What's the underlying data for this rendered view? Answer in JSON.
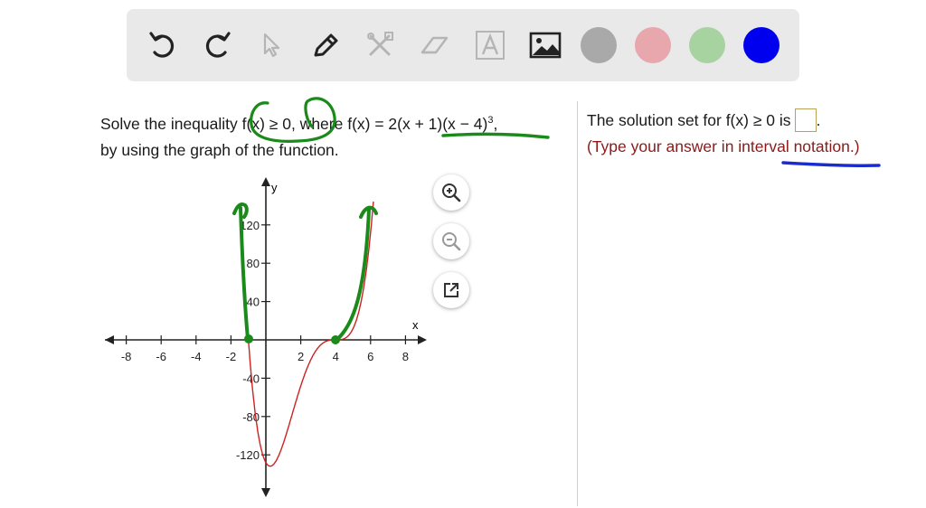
{
  "toolbar": {
    "tools": [
      "undo-icon",
      "redo-icon",
      "select-pointer-icon",
      "pen-icon",
      "tools-icon",
      "eraser-icon",
      "text-icon",
      "image-icon"
    ],
    "colors": [
      "#a9a9a9",
      "#e8a6ad",
      "#a7d3a1",
      "#0000ee"
    ]
  },
  "problem": {
    "part1": "Solve the inequality f(x) ≥ 0, where f(x) = 2(x + 1)(x − 4)",
    "exponent": "3",
    "part2": ",",
    "line2": "by using the graph of the function."
  },
  "answer": {
    "prompt": "The solution set for f(x) ≥ 0 is",
    "prompt_end": ".",
    "hint": "(Type your answer in interval notation.)",
    "value": ""
  },
  "graph": {
    "x_label": "x",
    "y_label": "y",
    "x_ticks": [
      "-8",
      "-6",
      "-4",
      "-2",
      "2",
      "4",
      "6",
      "8"
    ],
    "y_ticks": [
      "120",
      "80",
      "40",
      "-40",
      "-80",
      "-120"
    ],
    "curve_color": "#cc2222",
    "buttons": [
      "zoom-in-icon",
      "zoom-out-icon",
      "popout-icon"
    ]
  },
  "annotations": {
    "ink_color": "#1a8a1a",
    "hint_underline_color": "#1b2ccf"
  }
}
